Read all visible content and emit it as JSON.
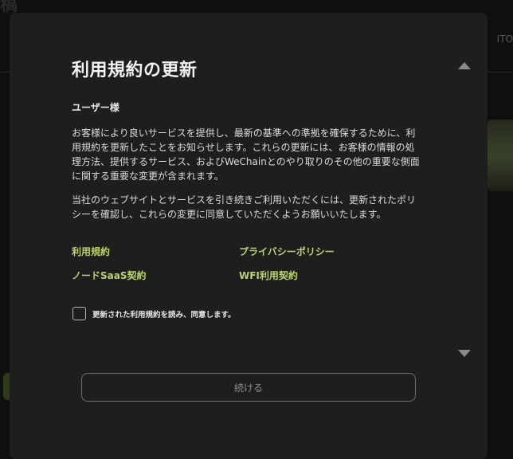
{
  "background": {
    "title": "稿",
    "top_right": "ITO"
  },
  "modal": {
    "title": "利用規約の更新",
    "greeting": "ユーザー様",
    "paragraphs": [
      "お客様により良いサービスを提供し、最新の基準への準拠を確保するために、利用規約を更新したことをお知らせします。これらの更新には、お客様の情報の処理方法、提供するサービス、およびWeChainとのやり取りのその他の重要な側面に関する重要な変更が含まれます。",
      "当社のウェブサイトとサービスを引き続きご利用いただくには、更新されたポリシーを確認し、これらの変更に同意していただくようお願いいたします。"
    ],
    "links": [
      "利用規約",
      "プライバシーポリシー",
      "ノードSaaS契約",
      "WFI利用契約"
    ],
    "agree_label": "更新された利用規約を読み、同意します。",
    "agree_checked": false,
    "continue_label": "続ける",
    "accent_color": "#b9d46e"
  }
}
